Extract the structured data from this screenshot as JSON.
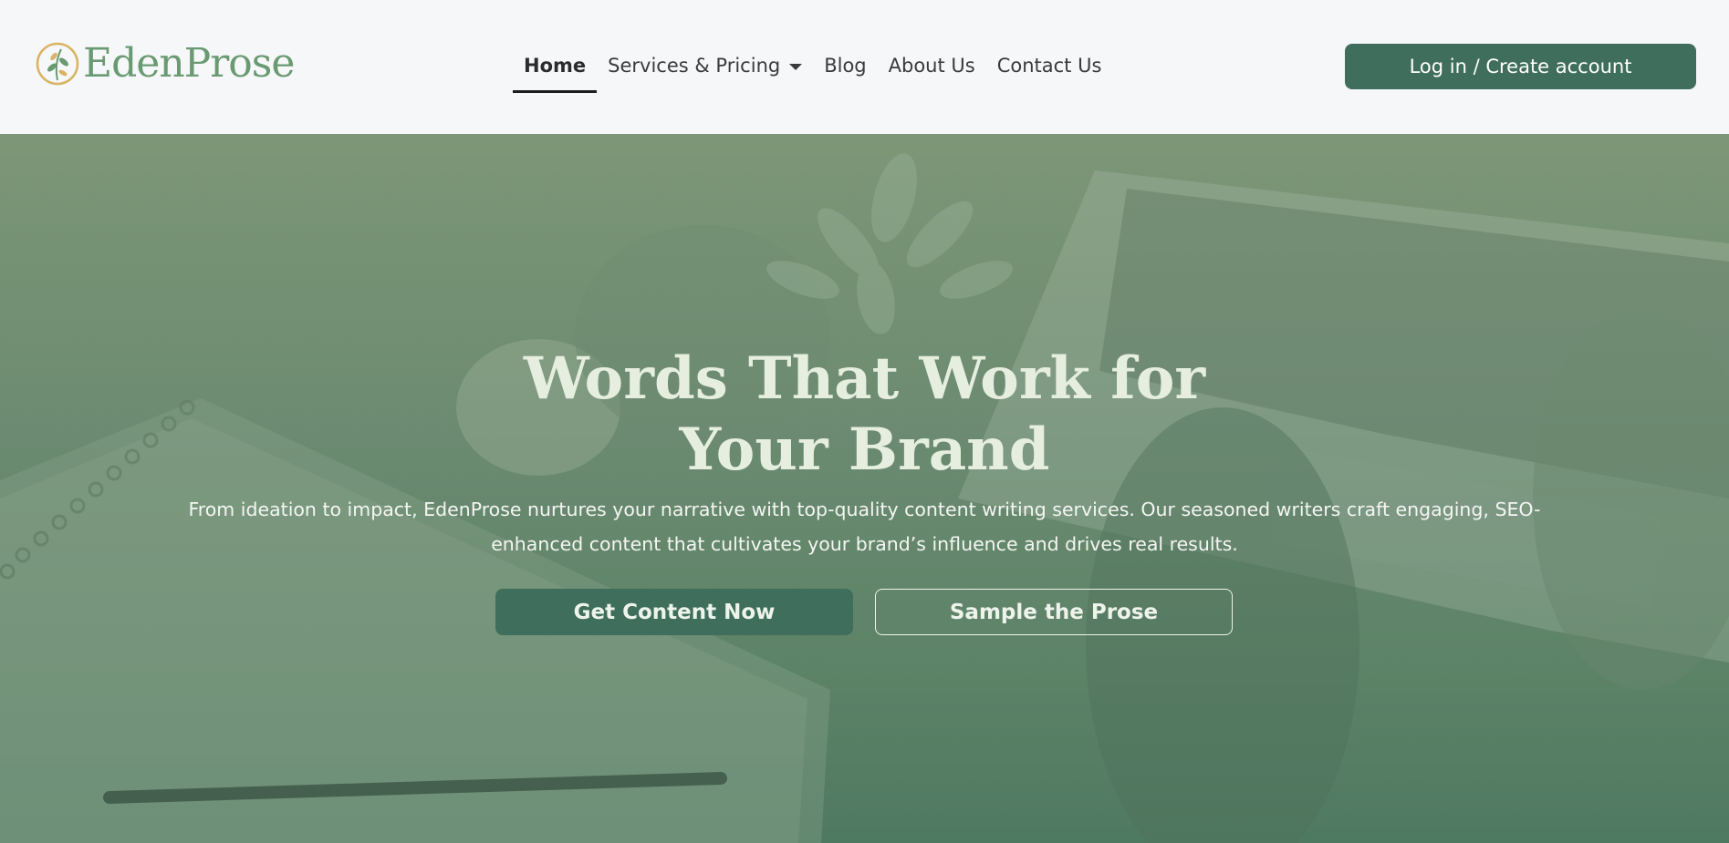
{
  "brand": {
    "name": "EdenProse",
    "logo_icon": "leaf-sprig-icon",
    "colors": {
      "brand_green": "#3f6e5c",
      "logo_text": "#6a9a72",
      "logo_gold": "#d8b463"
    }
  },
  "nav": {
    "items": [
      {
        "label": "Home",
        "active": true
      },
      {
        "label": "Services & Pricing",
        "has_dropdown": true
      },
      {
        "label": "Blog"
      },
      {
        "label": "About Us"
      },
      {
        "label": "Contact Us"
      }
    ],
    "login_label": "Log in / Create account"
  },
  "hero": {
    "title_line1": "Words That Work for",
    "title_line2": "Your Brand",
    "description_line1": "From ideation to impact, EdenProse nurtures your narrative with top-quality content writing services. Our seasoned writers craft engaging, SEO-",
    "description_line2": "enhanced content that cultivates your brand’s influence and drives real results.",
    "primary_cta": "Get Content Now",
    "secondary_cta": "Sample the Prose",
    "background_image": "desk-with-laptop-notebook-plant-photo"
  }
}
